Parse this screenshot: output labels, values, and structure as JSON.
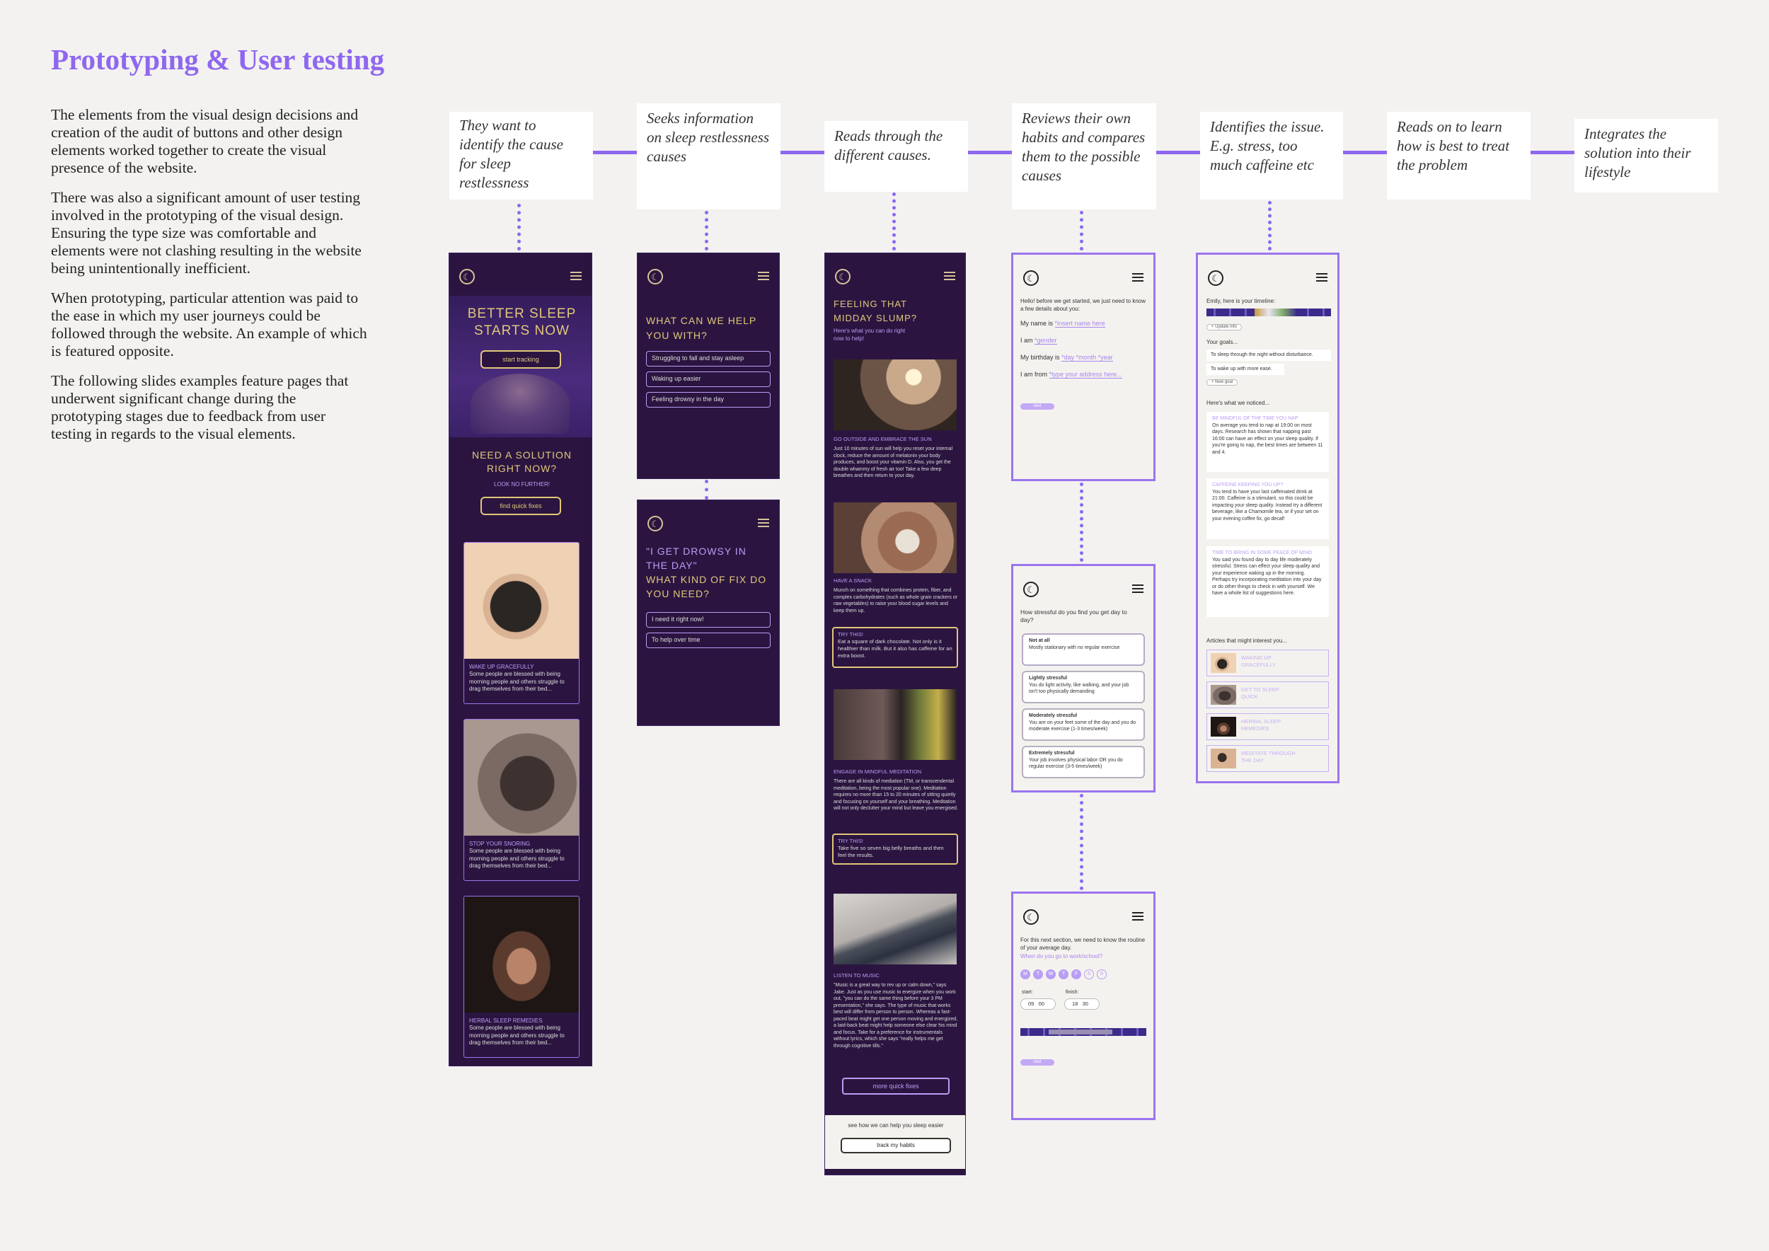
{
  "title": "Prototyping & User testing",
  "intro": [
    "The elements from the visual design decisions and creation of the audit of buttons and other design elements worked together to create the visual presence of the website.",
    "There was also a significant amount of user testing involved in the prototyping of the visual design. Ensuring the type size was comfortable and elements were not clashing resulting in the website being unintentionally inefficient.",
    "When prototyping, particular attention was paid to the ease in which my user journeys could be followed through the website. An example of which is featured opposite.",
    "The following slides examples feature pages that underwent significant change during the prototyping stages due to feedback from user testing in regards to the visual elements."
  ],
  "journey": [
    "They want to identify the cause for sleep restlessness",
    "Seeks information on sleep restlessness causes",
    "Reads through the different causes.",
    "Reviews their own habits and compares them to the possible causes",
    "Identifies the issue. E.g. stress, too much caffeine etc",
    "Reads on to learn how is best to treat the problem",
    "Integrates the solution into their lifestyle"
  ],
  "p1": {
    "headline": "BETTER SLEEP STARTS NOW",
    "cta": "start tracking",
    "need": "NEED A SOLUTION RIGHT NOW?",
    "look": "LOOK NO FURTHER!",
    "cta2": "find quick fixes",
    "cards": [
      {
        "title": "WAKE UP GRACEFULLY",
        "text": "Some people are blessed with being morning people and others struggle to drag themselves from their bed..."
      },
      {
        "title": "STOP YOUR SNORING",
        "text": "Some people are blessed with being morning people and others struggle to drag themselves from their bed..."
      },
      {
        "title": "HERBAL SLEEP REMEDIES",
        "text": "Some people are blessed with being morning people and others struggle to drag themselves from their bed..."
      }
    ]
  },
  "p2a": {
    "question": "WHAT CAN WE HELP YOU WITH?",
    "options": [
      "Struggling to fall and stay asleep",
      "Waking up easier",
      "Feeling drowsy in the day"
    ]
  },
  "p2b": {
    "quote": "\"I GET DROWSY IN THE DAY\"",
    "question": "WHAT KIND OF FIX DO YOU NEED?",
    "options": [
      "I need it right now!",
      "To help over time"
    ]
  },
  "p3": {
    "headline": "FEELING THAT MIDDAY SLUMP?",
    "sub": "Here's what you can do right now to help!",
    "sections": [
      {
        "title": "GO OUTSIDE AND EMBRACE THE SUN",
        "text": "Just 10 minutes of sun will help you reset your internal clock, reduce the amount of melatonin your body produces, and boost your vitamin D. Also, you get the double whammy of fresh air too! Take a few deep breathes and then return to your day."
      },
      {
        "title": "HAVE A SNACK",
        "text": "Munch on something that combines protein, fiber, and complex carbohydrates (such as whole grain crackers or raw vegetables) to raise your blood sugar levels and keep them up."
      },
      {
        "title": "ENGAGE IN MINDFUL MEDITATION",
        "text": "There are all kinds of mediation (TM, or transcendental meditation, being the most popular one). Meditation requires no more than 15 to 20 minutes of sitting quietly and focusing on yourself and your breathing. Meditation will not only declutter your mind but leave you energised."
      },
      {
        "title": "LISTEN TO MUSIC",
        "text": "\"Music is a great way to rev up or calm down,\" says Jake. Just as you use music to energize when you work out, \"you can do the same thing before your 3 PM presentation,\" she says. The type of music that works best will differ from person to person. Whereas a fast-paced beat might get one person moving and energized, a laid-back beat might help someone else clear his mind and focus. Take for a preference for instrumentals without lyrics, which she says \"really helps me get through cognitive tills.\""
      }
    ],
    "tries": [
      {
        "label": "TRY THIS!",
        "text": "Eat a square of dark chocolate. Not only is it healthier than milk. But it also has caffeine for an extra boost."
      },
      {
        "label": "TRY THIS!",
        "text": "Take five so seven big belly breaths and then feel the results."
      }
    ],
    "more": "more quick fixes",
    "footer": "see how we can help you sleep easier",
    "track": "track my habits"
  },
  "p4a": {
    "intro": "Hello! before we get started, we just need to know a few details about you:",
    "name_label": "My name is",
    "name_value": "*insert name here",
    "gender_label": "I am",
    "gender_value": "*gender",
    "bday_label": "My birthday is",
    "bday_value": "*day *month *year",
    "from_label": "I am from",
    "from_value": "*type your address here...",
    "next": "next"
  },
  "p4b": {
    "question": "How stressful do you find you get day to day?",
    "options": [
      {
        "title": "Not at all",
        "text": "Mostly stationary with no regular exercise"
      },
      {
        "title": "Lightly stressful",
        "text": "You do light activity, like walking, and your job isn't too physically demanding"
      },
      {
        "title": "Moderately stressful",
        "text": "You are on your feet some of the day and you do moderate exercise (1-3 times/week)"
      },
      {
        "title": "Extremely stressful",
        "text": "Your job involves physical labor OR you do regular exercise (3-5 times/week)"
      }
    ]
  },
  "p4c": {
    "intro": "For this next section, we need to know the routine of your average day.",
    "question": "When do you go to work/school?",
    "days": [
      "M",
      "T",
      "W",
      "T",
      "F",
      "S",
      "S"
    ],
    "start_label": "start:",
    "finish_label": "finish:",
    "start_h": "09",
    "start_m": "00",
    "finish_h": "18",
    "finish_m": "30",
    "next": "next"
  },
  "p5": {
    "timeline_label": "Emily, here is your timeline:",
    "update": "Update info",
    "goals_label": "Your goals...",
    "goals": [
      "To sleep through the night without disturbance.",
      "To wake up with more ease."
    ],
    "new_goal": "New goal",
    "noticed": "Here's what we noticed...",
    "notices": [
      {
        "title": "BE MINDFUL OF THE TIME YOU NAP",
        "text": "On average you tend to nap at 19:00 on most days. Research has shown that napping past 16:00 can have an effect on your sleep quality. If you're going to nap, the best times are between 11 and 4."
      },
      {
        "title": "CAFFEINE KEEPING YOU UP?",
        "text": "You tend to have your last caffeinated drink at 21:00. Caffeine is a stimulant, so this could be impacting your sleep quality. Instead try a different beverage, like a Chamomile tea, or if your set on your evening coffee fix, go decaf!"
      },
      {
        "title": "TIME TO BRING IN SOME PEACE OF MIND",
        "text": "You said you found day to day life moderately stressful. Stress can effect your sleep quality and your experience waking up in the morning. Perhaps try incorporating meditation into your day or do other things to check in with yourself. We have a whole list of suggestions here."
      }
    ],
    "articles_label": "Articles that might interest you...",
    "articles": [
      "WAKING UP GRACEFULLY",
      "GET TO SLEEP QUICK",
      "HERBAL SLEEP REMEDIES",
      "MEDITATE THROUGH THE DAY"
    ]
  },
  "colors": {
    "accent": "#8f67ef",
    "dark": "#2b1540",
    "gold": "#e2c77a",
    "lavender": "#b89ef5"
  }
}
